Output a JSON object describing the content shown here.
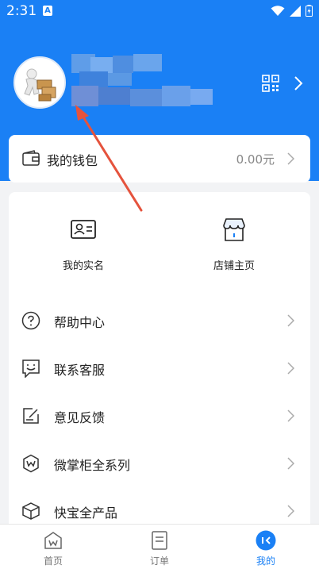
{
  "status_bar": {
    "time": "2:31",
    "notification_letter": "A"
  },
  "header": {
    "username": "",
    "qr_icon": "qr-code-icon",
    "arrow_icon": "chevron-right-icon"
  },
  "wallet": {
    "label": "我的钱包",
    "amount": "0.00元"
  },
  "shortcuts": [
    {
      "label": "我的实名",
      "icon": "id-card-icon"
    },
    {
      "label": "店铺主页",
      "icon": "store-icon"
    }
  ],
  "menu": [
    {
      "label": "帮助中心",
      "icon": "help-icon"
    },
    {
      "label": "联系客服",
      "icon": "customer-service-icon"
    },
    {
      "label": "意见反馈",
      "icon": "feedback-icon"
    },
    {
      "label": "微掌柜全系列",
      "icon": "shop-series-icon"
    },
    {
      "label": "快宝全产品",
      "icon": "box-icon"
    }
  ],
  "tabbar": [
    {
      "label": "首页",
      "icon": "home-icon",
      "active": false
    },
    {
      "label": "订单",
      "icon": "order-icon",
      "active": false
    },
    {
      "label": "我的",
      "icon": "profile-icon",
      "active": true
    }
  ],
  "colors": {
    "accent": "#1a80f5",
    "annotation_arrow": "#e5533d"
  }
}
